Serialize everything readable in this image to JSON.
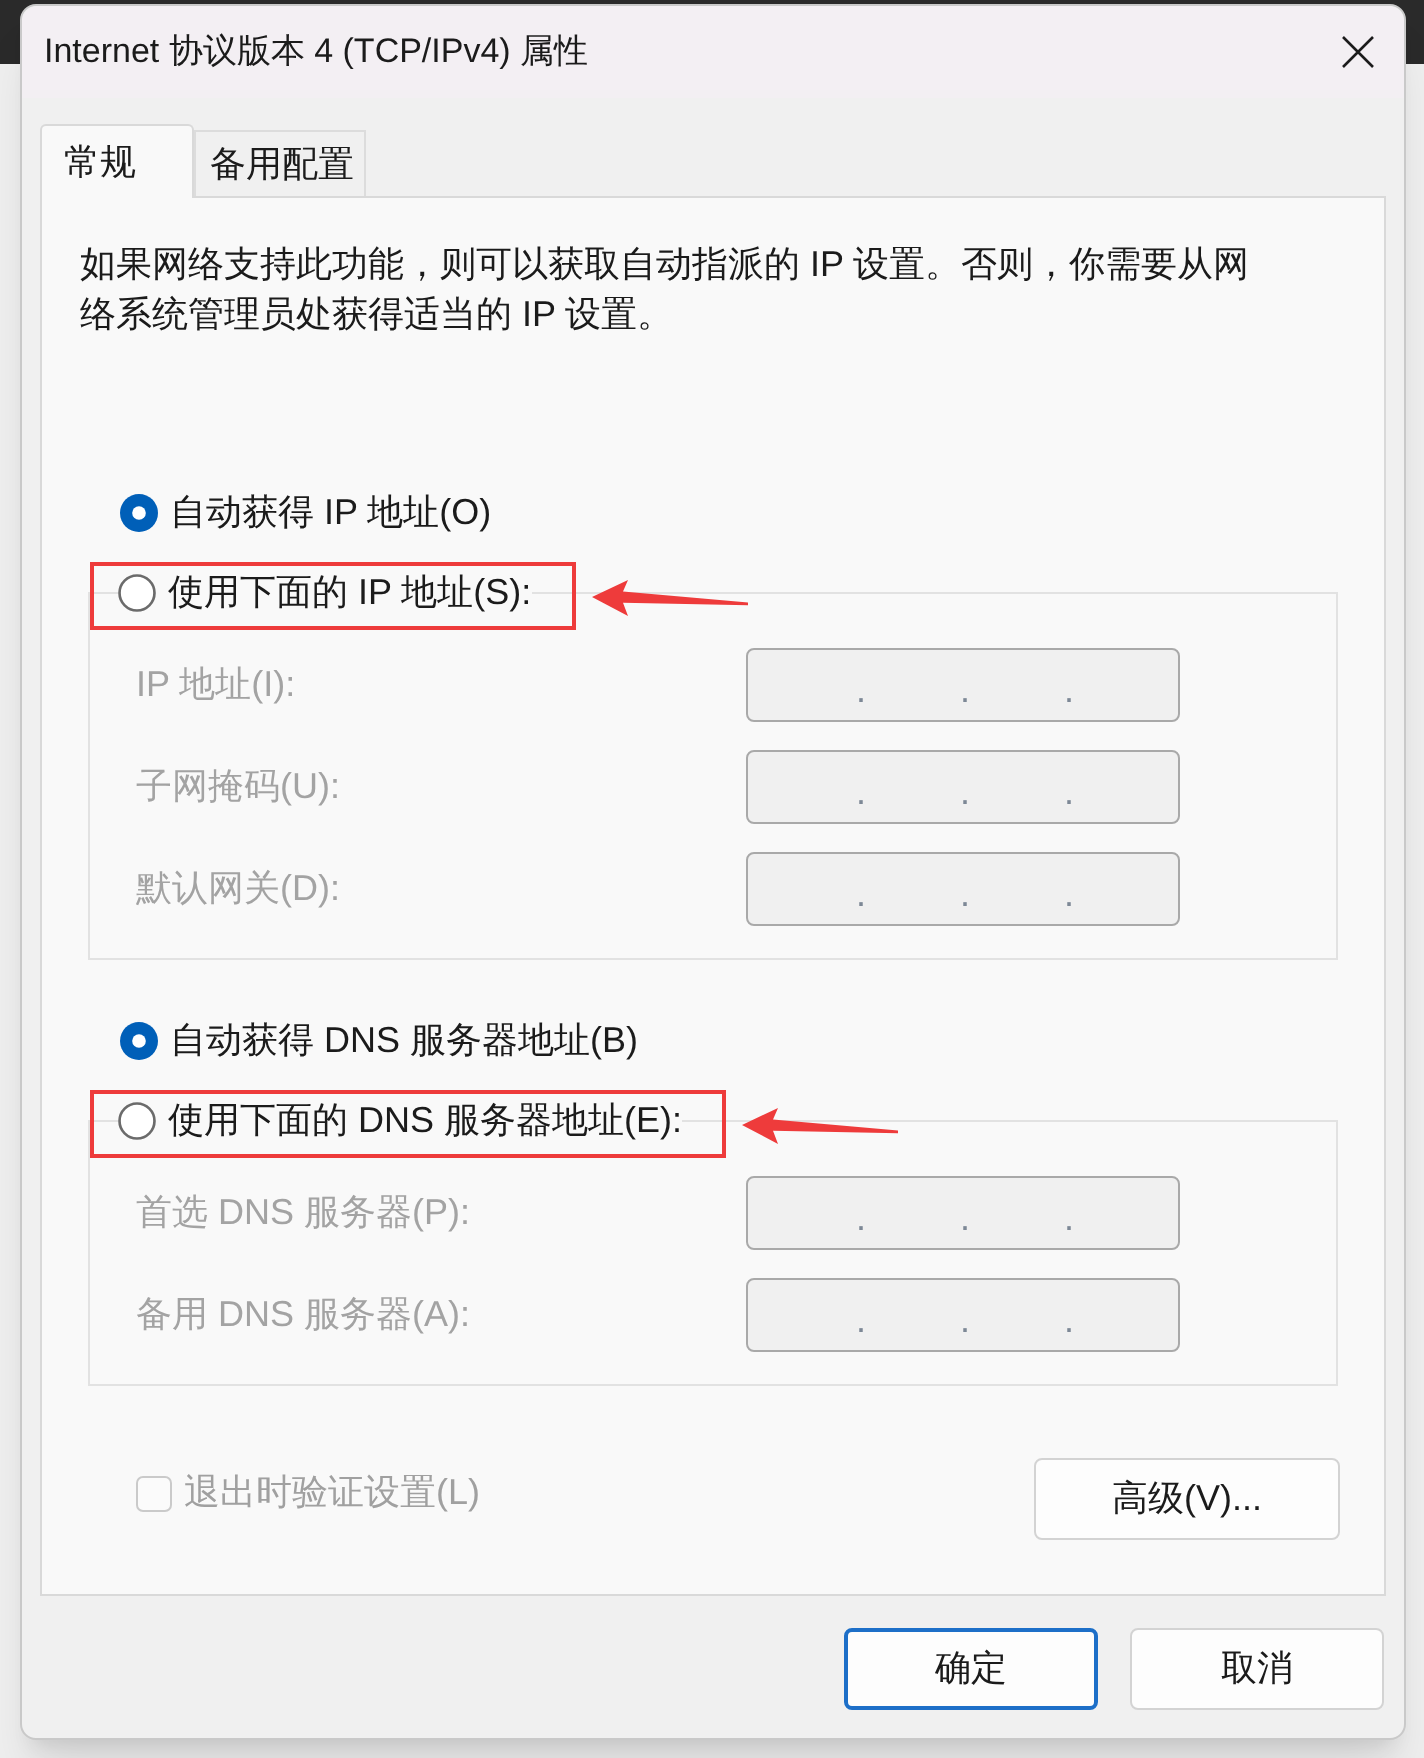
{
  "window": {
    "title": "Internet 协议版本 4 (TCP/IPv4) 属性"
  },
  "tabs": [
    {
      "label": "常规",
      "selected": true
    },
    {
      "label": "备用配置",
      "selected": false
    }
  ],
  "description": "如果网络支持此功能，则可以获取自动指派的 IP 设置。否则，你需要从网络系统管理员处获得适当的 IP 设置。",
  "ip_section": {
    "auto_option": {
      "label": "自动获得 IP 地址(O)",
      "selected": true,
      "annotated": false
    },
    "manual_option": {
      "label": "使用下面的 IP 地址(S):",
      "selected": false,
      "annotated": true
    },
    "fields": [
      {
        "label": "IP 地址(I):",
        "disabled": true,
        "separators": [
          ".",
          ".",
          "."
        ]
      },
      {
        "label": "子网掩码(U):",
        "disabled": true,
        "separators": [
          ".",
          ".",
          "."
        ]
      },
      {
        "label": "默认网关(D):",
        "disabled": true,
        "separators": [
          ".",
          ".",
          "."
        ]
      }
    ]
  },
  "dns_section": {
    "auto_option": {
      "label": "自动获得 DNS 服务器地址(B)",
      "selected": true,
      "annotated": false
    },
    "manual_option": {
      "label": "使用下面的 DNS 服务器地址(E):",
      "selected": false,
      "annotated": true
    },
    "fields": [
      {
        "label": "首选 DNS 服务器(P):",
        "disabled": true,
        "separators": [
          ".",
          ".",
          "."
        ]
      },
      {
        "label": "备用 DNS 服务器(A):",
        "disabled": true,
        "separators": [
          ".",
          ".",
          "."
        ]
      }
    ]
  },
  "validate_checkbox": {
    "label": "退出时验证设置(L)",
    "checked": false,
    "disabled": true
  },
  "advanced_button": {
    "label": "高级(V)..."
  },
  "buttons": [
    {
      "label": "确定",
      "default": true
    },
    {
      "label": "取消",
      "default": false
    }
  ]
}
